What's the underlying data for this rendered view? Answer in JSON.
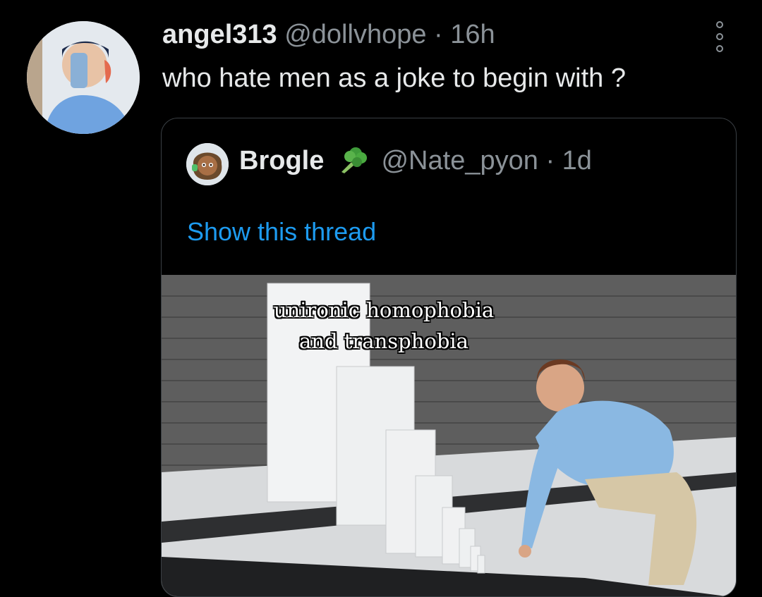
{
  "tweet": {
    "author_name": "angel313",
    "author_handle": "@dollvhope",
    "separator": "·",
    "time": "16h",
    "text": "who hate men as a joke to begin with ?"
  },
  "quoted_tweet": {
    "author_name": "Brogle",
    "emoji": "broccoli-icon",
    "author_handle": "@Nate_pyon",
    "separator": "·",
    "time": "1d",
    "show_thread_label": "Show this thread",
    "image_caption": "unironic homophobia and transphobia"
  },
  "colors": {
    "background": "#000000",
    "text": "#e7e9ea",
    "muted": "#8b9298",
    "link": "#1d9bf0",
    "border": "#3a3f44"
  }
}
